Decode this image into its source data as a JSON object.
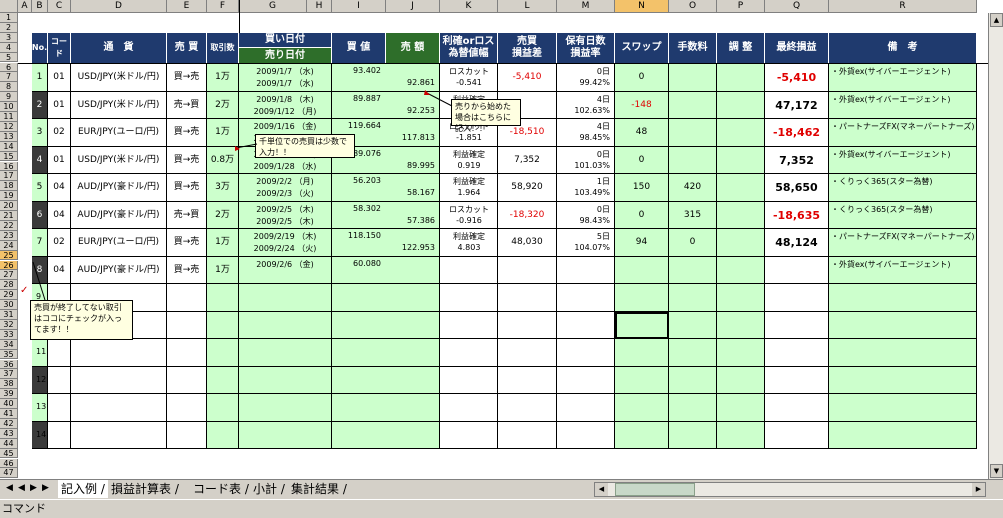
{
  "col_headers": [
    "A",
    "B",
    "C",
    "D",
    "E",
    "F",
    "G",
    "H",
    "I",
    "J",
    "K",
    "L",
    "M",
    "N",
    "O",
    "P",
    "Q",
    "R"
  ],
  "selected_col": "N",
  "row_numbers": [
    "1",
    "2",
    "3",
    "4",
    "5",
    "6",
    "7",
    "8",
    "9",
    "10",
    "11",
    "12",
    "13",
    "14",
    "15",
    "16",
    "17",
    "18",
    "19",
    "20",
    "21",
    "22",
    "23",
    "24",
    "25",
    "26",
    "27",
    "28",
    "29",
    "30",
    "31",
    "32",
    "33",
    "34",
    "35",
    "36",
    "37",
    "38",
    "39",
    "40",
    "41",
    "42",
    "43",
    "44",
    "45",
    "46",
    "47"
  ],
  "table_headers": {
    "no": "No.",
    "code": "コード",
    "currency": "通　貨",
    "direction": "売 買",
    "qty": "取引数",
    "buy_date": "買い日付",
    "sell_date": "売り日付",
    "buy_value": "買 値",
    "sell_value": "売 額",
    "result_top": "利確orロス",
    "result_bottom": "為替値幅",
    "pnl_top": "売買",
    "pnl_bottom": "損益差",
    "hold_top": "保有日数",
    "hold_bottom": "損益率",
    "swap": "スワップ",
    "fee": "手数料",
    "adjust": "調 整",
    "final": "最終損益",
    "remarks": "備　考"
  },
  "rows": [
    {
      "no": "1",
      "code": "01",
      "currency": "USD/JPY(米ドル/円)",
      "dir": "買→売",
      "qty": "1万",
      "buy_date": "2009/1/7 （水)",
      "sell_date": "2009/1/7 （水)",
      "buy_value": "93.402",
      "sell_value": "92.861",
      "result": "ロスカット",
      "diff": "-0.541",
      "pnl": "-5,410",
      "hold": "0日",
      "rate": "99.42%",
      "swap": "0",
      "fee": "",
      "adjust": "",
      "final": "-5,410",
      "remarks": "・外貨ex(サイバーエージェント)",
      "neg": true,
      "final_neg": true
    },
    {
      "no": "2",
      "code": "01",
      "currency": "USD/JPY(米ドル/円)",
      "dir": "売→買",
      "qty": "2万",
      "buy_date": "2009/1/8 （木)",
      "sell_date": "2009/1/12 （月)",
      "buy_value": "89.887",
      "sell_value": "92.253",
      "result": "利益確定",
      "diff": "",
      "pnl": "",
      "hold": "4日",
      "rate": "102.63%",
      "swap": "-148",
      "fee": "",
      "adjust": "",
      "final": "47,172",
      "remarks": "・外貨ex(サイバーエージェント)",
      "neg": false,
      "final_neg": false,
      "swap_neg": true
    },
    {
      "no": "3",
      "code": "02",
      "currency": "EUR/JPY(ユーロ/円)",
      "dir": "買→売",
      "qty": "1万",
      "buy_date": "2009/1/16 （金)",
      "sell_date": "2009/1/20 （火)",
      "buy_value": "119.664",
      "sell_value": "117.813",
      "result": "ロスカット",
      "diff": "-1.851",
      "pnl": "-18,510",
      "hold": "4日",
      "rate": "98.45%",
      "swap": "48",
      "fee": "",
      "adjust": "",
      "final": "-18,462",
      "remarks": "・パートナーズFX(マネーパートナーズ)",
      "neg": true,
      "final_neg": true
    },
    {
      "no": "4",
      "code": "01",
      "currency": "USD/JPY(米ドル/円)",
      "dir": "買→売",
      "qty": "0.8万",
      "buy_date": "2009/1/28 （水)",
      "sell_date": "2009/1/28 （水)",
      "buy_value": "89.076",
      "sell_value": "89.995",
      "result": "利益確定",
      "diff": "0.919",
      "pnl": "7,352",
      "hold": "0日",
      "rate": "101.03%",
      "swap": "0",
      "fee": "",
      "adjust": "",
      "final": "7,352",
      "remarks": "・外貨ex(サイバーエージェント)",
      "neg": false,
      "final_neg": false
    },
    {
      "no": "5",
      "code": "04",
      "currency": "AUD/JPY(豪ドル/円)",
      "dir": "買→売",
      "qty": "3万",
      "buy_date": "2009/2/2 （月)",
      "sell_date": "2009/2/3 （火)",
      "buy_value": "56.203",
      "sell_value": "58.167",
      "result": "利益確定",
      "diff": "1.964",
      "pnl": "58,920",
      "hold": "1日",
      "rate": "103.49%",
      "swap": "150",
      "fee": "420",
      "adjust": "",
      "final": "58,650",
      "remarks": "・くりっく365(スター為替)",
      "neg": false,
      "final_neg": false
    },
    {
      "no": "6",
      "code": "04",
      "currency": "AUD/JPY(豪ドル/円)",
      "dir": "売→買",
      "qty": "2万",
      "buy_date": "2009/2/5 （木)",
      "sell_date": "2009/2/5 （木)",
      "buy_value": "58.302",
      "sell_value": "57.386",
      "result": "ロスカット",
      "diff": "-0.916",
      "pnl": "-18,320",
      "hold": "0日",
      "rate": "98.43%",
      "swap": "0",
      "fee": "315",
      "adjust": "",
      "final": "-18,635",
      "remarks": "・くりっく365(スター為替)",
      "neg": true,
      "final_neg": true
    },
    {
      "no": "7",
      "code": "02",
      "currency": "EUR/JPY(ユーロ/円)",
      "dir": "買→売",
      "qty": "1万",
      "buy_date": "2009/2/19 （木)",
      "sell_date": "2009/2/24 （火)",
      "buy_value": "118.150",
      "sell_value": "122.953",
      "result": "利益確定",
      "diff": "4.803",
      "pnl": "48,030",
      "hold": "5日",
      "rate": "104.07%",
      "swap": "94",
      "fee": "0",
      "adjust": "",
      "final": "48,124",
      "remarks": "・パートナーズFX(マネーパートナーズ)",
      "neg": false,
      "final_neg": false
    },
    {
      "no": "8",
      "code": "04",
      "currency": "AUD/JPY(豪ドル/円)",
      "dir": "買→売",
      "qty": "1万",
      "buy_date": "2009/2/6 （金)",
      "sell_date": "",
      "buy_value": "60.080",
      "sell_value": "",
      "result": "",
      "diff": "",
      "pnl": "",
      "hold": "",
      "rate": "",
      "swap": "",
      "fee": "",
      "adjust": "",
      "final": "",
      "remarks": "・外貨ex(サイバーエージェント)",
      "neg": false,
      "final_neg": false
    }
  ],
  "empty_rows": [
    "9",
    "10",
    "11",
    "12",
    "13",
    "14"
  ],
  "callouts": {
    "sell_first": "売りから始めた場合はこちらに記入！！",
    "small_units": "千単位での売買は少数で入力！！",
    "unfinished": "売買が終了してない取引はココにチェックが入ってます！！"
  },
  "tabs": [
    "記入例",
    "損益計算表",
    "コード表",
    "小計",
    "集計結果"
  ],
  "active_tab": "記入例",
  "status_text": "コマンド",
  "colors": {
    "header_blue": "#1f3a6e",
    "header_green": "#2e6e2a",
    "cell_green": "#ccffcc",
    "negative": "#e00000"
  }
}
